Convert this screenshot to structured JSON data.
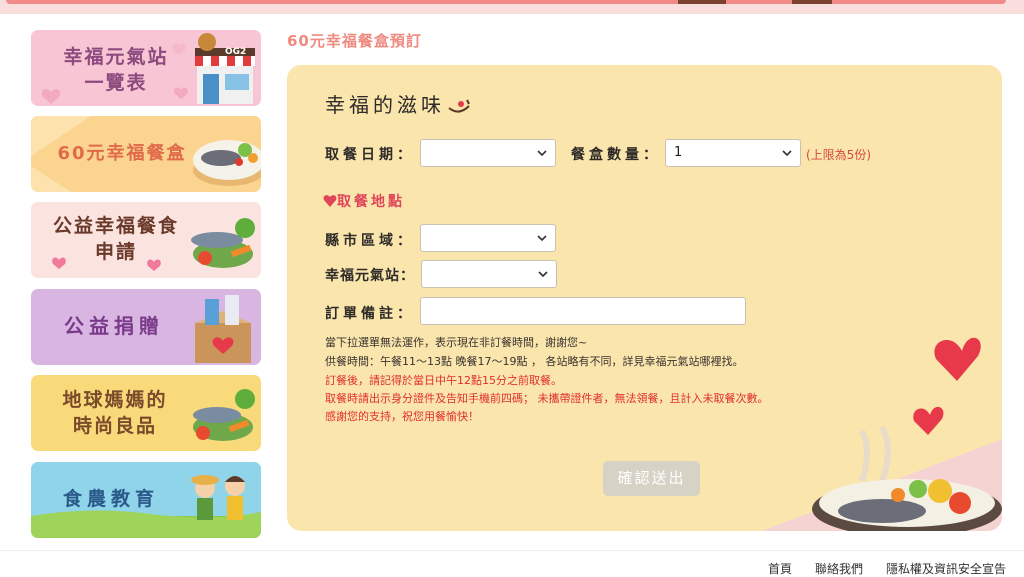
{
  "sidebar": {
    "tiles": [
      {
        "label": "幸福元氣站\n一覽表",
        "shop_sign": "OG2"
      },
      {
        "label": "60元幸福餐盒"
      },
      {
        "label": "公益幸福餐食\n申請"
      },
      {
        "label": "公益捐贈"
      },
      {
        "label": "地球媽媽的\n時尚良品"
      },
      {
        "label": "食農教育"
      }
    ]
  },
  "main": {
    "page_title": "60元幸福餐盒預訂",
    "heading": "幸福的滋味",
    "pickup_date_label": "取餐日期：",
    "pickup_date_value": "",
    "quantity_label": "餐盒數量：",
    "quantity_value": "1",
    "quantity_limit_note": "(上限為5份)",
    "pickup_location_label": "取餐地點",
    "district_label": "縣市區域：",
    "district_value": "",
    "station_label": "幸福元氣站：",
    "station_value": "",
    "remarks_label": "訂單備註：",
    "remarks_value": "",
    "notes": [
      {
        "text": "當下拉選單無法運作，表示現在非訂餐時間，謝謝您~",
        "color": "#3a3330"
      },
      {
        "text": "供餐時間：午餐11～13點 晚餐17～19點 ， 各站略有不同，詳見幸福元氣站哪裡找。",
        "color": "#3a3330"
      },
      {
        "text": "訂餐後，請記得於當日中午12點15分之前取餐。",
        "color": "#e0302a"
      },
      {
        "text": "取餐時請出示身分證件及告知手機前四碼； 未攜帶證件者，無法領餐，且計入未取餐次數。",
        "color": "#e0302a"
      },
      {
        "text": "感謝您的支持，祝您用餐愉快！",
        "color": "#e0302a"
      }
    ],
    "submit_label": "確認送出"
  },
  "footer": {
    "links": [
      "首頁",
      "聯絡我們",
      "隱私權及資訊安全宣告"
    ]
  },
  "colors": {
    "panel_bg": "#fae5ad",
    "title_accent": "#ee8a80",
    "warning": "#e0302a",
    "section_accent": "#e0455a",
    "submit_disabled": "#d7d2c6"
  },
  "icons": [
    "heart-icon",
    "chevron-down-icon",
    "shop-icon",
    "bento-icon",
    "vegetables-icon",
    "donation-box-icon",
    "farmer-kids-icon"
  ]
}
